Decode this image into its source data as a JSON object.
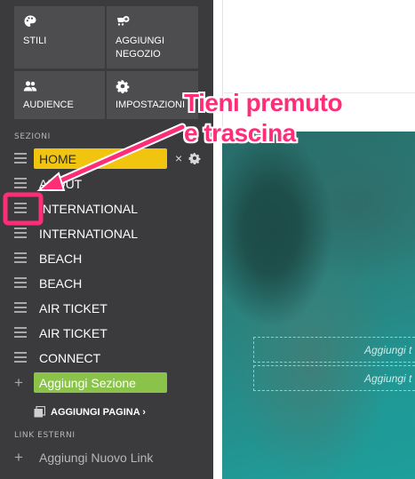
{
  "tiles": {
    "styles": {
      "label": "STILI",
      "icon": "palette-icon"
    },
    "add_shop": {
      "label": "AGGIUNGI NEGOZIO",
      "icon": "add-shop-icon"
    },
    "audience": {
      "label": "AUDIENCE",
      "icon": "people-icon"
    },
    "settings": {
      "label": "IMPOSTAZIONI",
      "icon": "gear-icon"
    }
  },
  "sections": {
    "heading": "SEZIONI",
    "items": [
      {
        "label": "HOME",
        "highlight": "#f1c40f"
      },
      {
        "label": "ABOUT"
      },
      {
        "label": "INTERNATIONAL"
      },
      {
        "label": "INTERNATIONAL"
      },
      {
        "label": "BEACH"
      },
      {
        "label": "BEACH"
      },
      {
        "label": "AIR TICKET"
      },
      {
        "label": "AIR TICKET"
      },
      {
        "label": "CONNECT"
      }
    ],
    "home_remove": "×",
    "add_section": "Aggiungi Sezione",
    "add_section_color": "#8bc34a",
    "add_page": "AGGIUNGI PAGINA",
    "add_page_chevron": "›"
  },
  "external_links": {
    "heading": "LINK ESTERNI",
    "add_link": "Aggiungi Nuovo Link"
  },
  "canvas": {
    "placeholder_1": "Aggiungi t",
    "placeholder_2": "Aggiungi t"
  },
  "annotation": {
    "line1": "Tieni premuto",
    "line2": "e trascina",
    "color": "#ff2d78"
  },
  "colors": {
    "sidebar_bg": "#3b3b3d",
    "tile_bg": "#4d4d50",
    "accent_yellow": "#f1c40f",
    "accent_green": "#8bc34a",
    "annotation_pink": "#ff2d78"
  }
}
